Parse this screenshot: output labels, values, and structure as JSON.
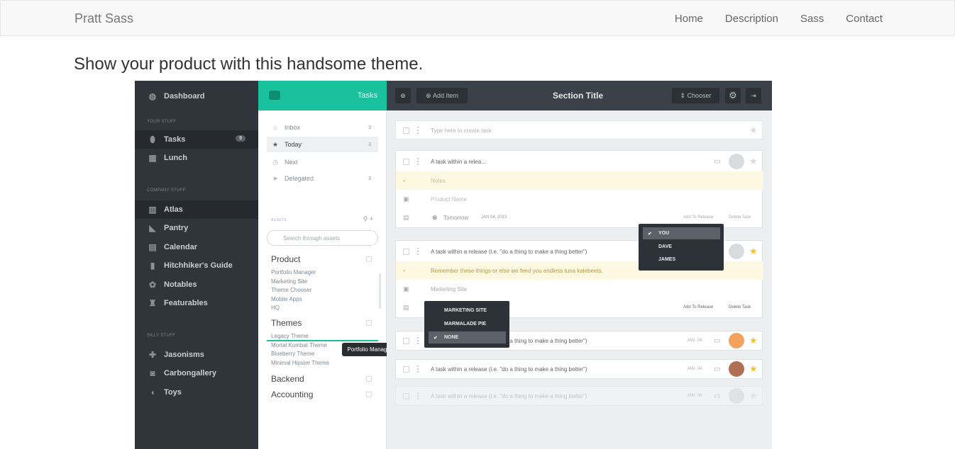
{
  "nav": {
    "brand": "Pratt Sass",
    "links": [
      "Home",
      "Description",
      "Sass",
      "Contact"
    ]
  },
  "headline": "Show your product with this handsome theme.",
  "app": {
    "sidebar": {
      "dashboard": "Dashboard",
      "section1": "YOUR STUFF",
      "section2": "COMPANY STUFF",
      "section3": "SILLY STUFF",
      "tasks_badge": "9",
      "items": [
        "Tasks",
        "Lunch",
        "Atlas",
        "Pantry",
        "Calendar",
        "Hitchhiker's Guide",
        "Notables",
        "Featurables",
        "Jasonisms",
        "Carbongallery",
        "Toys"
      ]
    },
    "middle": {
      "header": "Tasks",
      "lists": [
        {
          "label": "Inbox",
          "count": "3"
        },
        {
          "label": "Today",
          "count": "3"
        },
        {
          "label": "Next",
          "count": ""
        },
        {
          "label": "Delegated",
          "count": "3"
        }
      ],
      "assets_label": "ASSETS",
      "search_placeholder": "Search through assets",
      "groups": [
        "Product",
        "Themes",
        "Backend",
        "Accounting"
      ],
      "product_items": [
        "Portfolio Manager",
        "Marketing Site",
        "Theme Chooser",
        "Mobile Apps",
        "HQ"
      ],
      "theme_items": [
        "Legacy Theme",
        "Mortal Kombat Theme",
        "Blueberry Theme",
        "Minimal Hipster Theme"
      ],
      "tooltip": "Portfolio Manager"
    },
    "main": {
      "add_item": "Add Item",
      "title": "Section Title",
      "chooser": "Chooser",
      "create_placeholder": "Type here to create task",
      "task1": "A task within a relea...",
      "notes_placeholder": "Notes",
      "product_placeholder": "Product Name",
      "tomorrow": "Tomorrow",
      "date1": "JAN 04, 2013",
      "add_to_release": "Add To Release",
      "delete_task": "Delete Task",
      "task2": "A task within a release (i.e. \"do a thing to make a thing better\")",
      "note2": "Remember these things or else we feed you endless tuna kalebeets.",
      "product2": "Marketing Site",
      "task3": "A task within a release (i.e. \"do a thing to make a thing better\")",
      "task4": "A task within a release (i.e. \"do a thing to make a thing better\")",
      "task5": "A task within a release (i.e. \"do a thing to make a thing better\")",
      "jan04": "JAN. 04",
      "assignees": [
        "YOU",
        "DAVE",
        "JAMES"
      ],
      "products": [
        "MARKETING SITE",
        "MARMALADE PIE",
        "NONE"
      ]
    }
  }
}
